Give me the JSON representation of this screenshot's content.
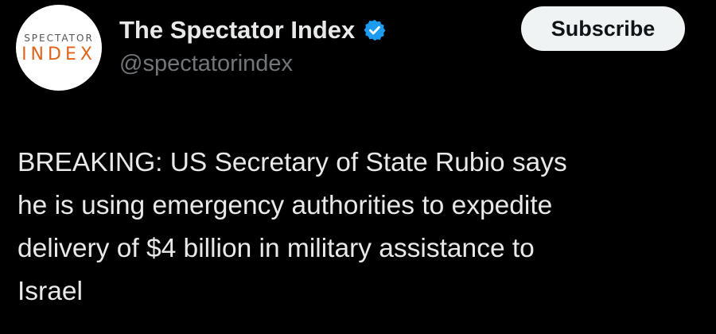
{
  "author": {
    "display_name": "The Spectator Index",
    "handle": "@spectatorindex",
    "verified": true,
    "avatar_logo": {
      "top_word": "SPECTATOR",
      "bottom_word": "INDEX"
    }
  },
  "actions": {
    "subscribe_label": "Subscribe"
  },
  "tweet": {
    "lines": [
      "BREAKING: US Secretary of State Rubio says",
      "he is using emergency authorities to expedite",
      "delivery of $4 billion in military assistance to",
      "Israel"
    ]
  },
  "colors": {
    "background": "#000000",
    "text_primary": "#e7e9ea",
    "text_secondary": "#71767b",
    "verified_badge": "#1d9bf0",
    "button_bg": "#eff3f4",
    "logo_accent": "#e0631c"
  }
}
